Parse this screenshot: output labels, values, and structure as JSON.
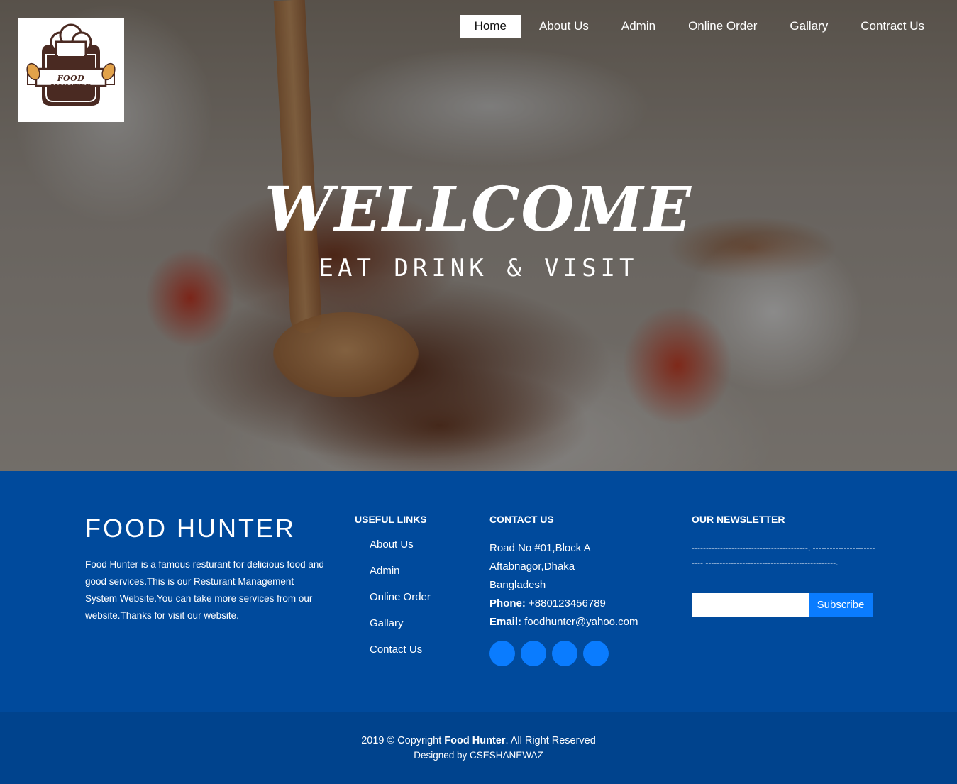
{
  "colors": {
    "footer_bg": "#004a9c",
    "bottom_bar_bg": "#00438d",
    "accent_blue": "#0a7cff",
    "logo_brown": "#4a2a22"
  },
  "logo": {
    "text": "FOOD HUNTER",
    "icon": "chef-hat-icon"
  },
  "nav": {
    "items": [
      {
        "label": "Home",
        "active": true
      },
      {
        "label": "About Us"
      },
      {
        "label": "Admin"
      },
      {
        "label": "Online Order"
      },
      {
        "label": "Gallary"
      },
      {
        "label": "Contract Us"
      }
    ]
  },
  "hero": {
    "title": "WELLCOME",
    "subtitle": "EAT DRINK & VISIT"
  },
  "footer": {
    "brand": {
      "title": "FOOD HUNTER",
      "description": "Food Hunter is a famous resturant for delicious food and good services.This is our Resturant Management System Website.You can take more services from our website.Thanks for visit our website."
    },
    "useful_links": {
      "heading": "USEFUL LINKS",
      "items": [
        "About Us",
        "Admin",
        "Online Order",
        "Gallary",
        "Contact Us"
      ]
    },
    "contact": {
      "heading": "CONTACT US",
      "address_line1": "Road No #01,Block A",
      "address_line2": "Aftabnagor,Dhaka",
      "address_line3": "Bangladesh",
      "phone_label": "Phone:",
      "phone": "+880123456789",
      "email_label": "Email:",
      "email": "foodhunter@yahoo.com",
      "socials": [
        "social-icon-1",
        "social-icon-2",
        "social-icon-3",
        "social-icon-4"
      ]
    },
    "newsletter": {
      "heading": "OUR NEWSLETTER",
      "text": "-----------------------------------------. -------------------------- ----------------------------------------------.",
      "input_value": "",
      "button_label": "Subscribe"
    }
  },
  "bottom": {
    "copyright_prefix": "2019 © Copyright ",
    "copyright_brand": "Food Hunter",
    "copyright_suffix": ". All Right Reserved",
    "designed_by": "Designed by CSESHANEWAZ"
  }
}
